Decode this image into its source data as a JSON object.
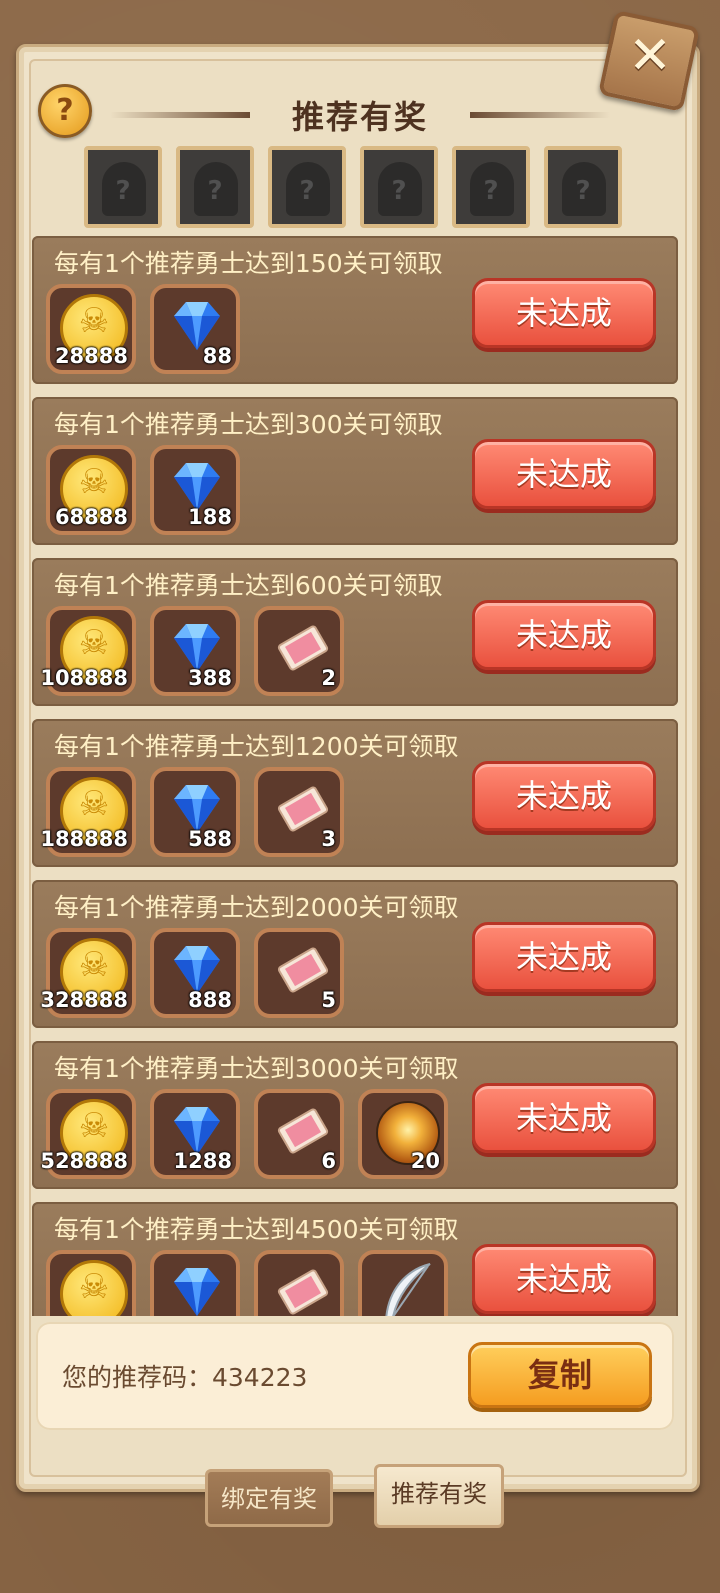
{
  "header": {
    "title": "推荐有奖",
    "help_symbol": "?",
    "close_symbol": "✕"
  },
  "referrals": {
    "slots": 6,
    "placeholder_symbol": "?"
  },
  "reward_rows": [
    {
      "condition": "每有1个推荐勇士达到150关可领取",
      "status": "未达成",
      "items": [
        {
          "icon": "gold-coin-icon",
          "count": "28888"
        },
        {
          "icon": "diamond-icon",
          "count": "88"
        }
      ]
    },
    {
      "condition": "每有1个推荐勇士达到300关可领取",
      "status": "未达成",
      "items": [
        {
          "icon": "gold-coin-icon",
          "count": "68888"
        },
        {
          "icon": "diamond-icon",
          "count": "188"
        }
      ]
    },
    {
      "condition": "每有1个推荐勇士达到600关可领取",
      "status": "未达成",
      "items": [
        {
          "icon": "gold-coin-icon",
          "count": "108888"
        },
        {
          "icon": "diamond-icon",
          "count": "388"
        },
        {
          "icon": "ticket-icon",
          "count": "2"
        }
      ]
    },
    {
      "condition": "每有1个推荐勇士达到1200关可领取",
      "status": "未达成",
      "items": [
        {
          "icon": "gold-coin-icon",
          "count": "188888"
        },
        {
          "icon": "diamond-icon",
          "count": "588"
        },
        {
          "icon": "ticket-icon",
          "count": "3"
        }
      ]
    },
    {
      "condition": "每有1个推荐勇士达到2000关可领取",
      "status": "未达成",
      "items": [
        {
          "icon": "gold-coin-icon",
          "count": "328888"
        },
        {
          "icon": "diamond-icon",
          "count": "888"
        },
        {
          "icon": "ticket-icon",
          "count": "5"
        }
      ]
    },
    {
      "condition": "每有1个推荐勇士达到3000关可领取",
      "status": "未达成",
      "items": [
        {
          "icon": "gold-coin-icon",
          "count": "528888"
        },
        {
          "icon": "diamond-icon",
          "count": "1288"
        },
        {
          "icon": "ticket-icon",
          "count": "6"
        },
        {
          "icon": "golden-orb-icon",
          "count": "20"
        }
      ]
    },
    {
      "condition": "每有1个推荐勇士达到4500关可领取",
      "status": "未达成",
      "items": [
        {
          "icon": "gold-coin-icon",
          "count": ""
        },
        {
          "icon": "diamond-icon",
          "count": ""
        },
        {
          "icon": "ticket-icon",
          "count": ""
        },
        {
          "icon": "feather-icon",
          "count": ""
        }
      ]
    }
  ],
  "referral_code": {
    "label": "您的推荐码：434223",
    "copy_label": "复制"
  },
  "tabs": [
    {
      "label": "绑定有奖",
      "active": false
    },
    {
      "label": "推荐有奖",
      "active": true
    }
  ],
  "colors": {
    "panel": "#efe3ca",
    "row": "#9a7c5c",
    "status_button": "#e9513e",
    "copy_button": "#f59d21"
  }
}
